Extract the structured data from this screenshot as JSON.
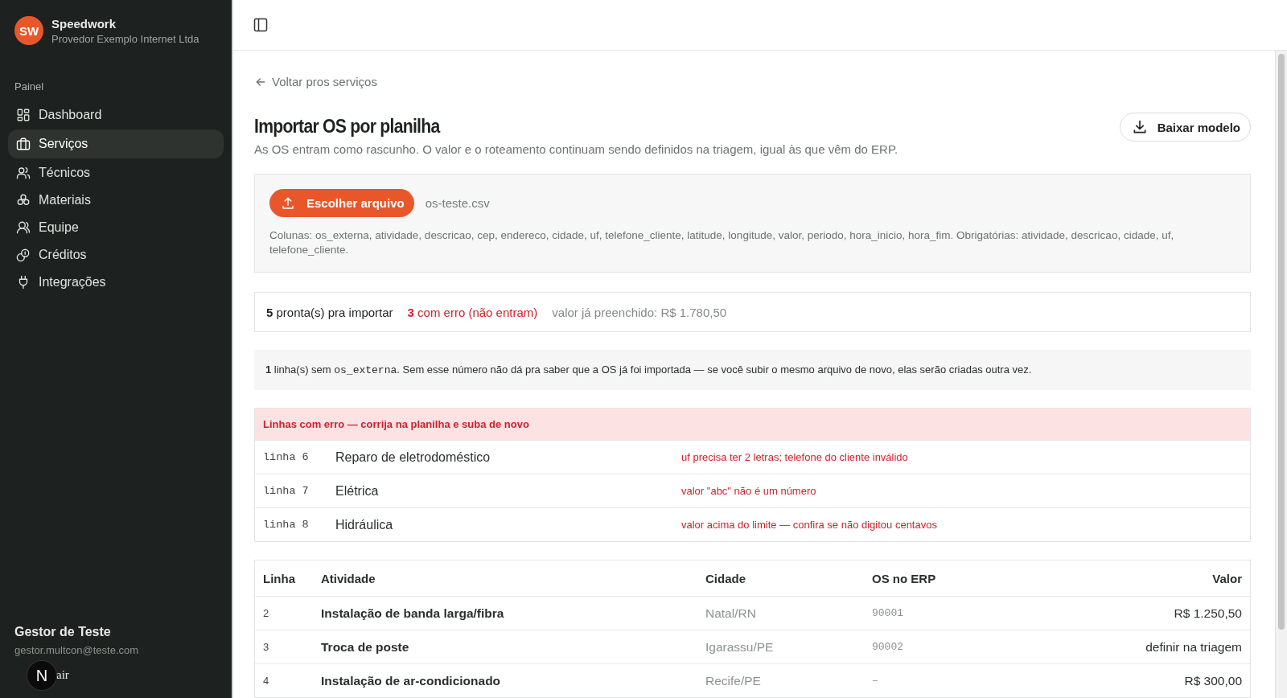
{
  "org": {
    "initials": "SW",
    "name": "Speedwork",
    "subtitle": "Provedor Exemplo Internet Ltda"
  },
  "sidebar": {
    "section": "Painel",
    "items": [
      {
        "label": "Dashboard",
        "selected": false
      },
      {
        "label": "Serviços",
        "selected": true
      },
      {
        "label": "Técnicos",
        "selected": false
      },
      {
        "label": "Materiais",
        "selected": false
      },
      {
        "label": "Equipe",
        "selected": false
      },
      {
        "label": "Créditos",
        "selected": false
      },
      {
        "label": "Integrações",
        "selected": false
      }
    ]
  },
  "user": {
    "name": "Gestor de Teste",
    "email": "gestor.multcon@teste.com",
    "logout": "air",
    "badge": "N"
  },
  "back_link": "Voltar pros serviços",
  "title": "Importar OS por planilha",
  "subtitle": "As OS entram como rascunho. O valor e o roteamento continuam sendo definidos na triagem, igual às que vêm do ERP.",
  "download_button": "Baixar modelo",
  "upload": {
    "button": "Escolher arquivo",
    "file": "os-teste.csv",
    "columns_note": "Colunas: os_externa, atividade, descricao, cep, endereco, cidade, uf, telefone_cliente, latitude, longitude, valor, periodo, hora_inicio, hora_fim. Obrigatórias: atividade, descricao, cidade, uf, telefone_cliente."
  },
  "summary": {
    "ready": "**5** pronta(s) pra importar",
    "errors": "**3** com erro (não entram)",
    "filled": "valor já preenchido: R$ 1.780,50"
  },
  "warning": [
    {
      "kind": "bold",
      "text": "1"
    },
    {
      "kind": "text",
      "text": " linha(s) sem "
    },
    {
      "kind": "code",
      "text": "os_externa"
    },
    {
      "kind": "text",
      "text": ". Sem esse número não dá pra saber que a OS já foi importada — se você subir o mesmo arquivo de novo, elas serão criadas outra vez."
    }
  ],
  "errors": {
    "title": "Linhas com erro — corrija na planilha e suba de novo",
    "rows": [
      {
        "line": "linha 6",
        "activity": "Reparo de eletrodoméstico",
        "message": "uf precisa ter 2 letras; telefone do cliente inválido"
      },
      {
        "line": "linha 7",
        "activity": "Elétrica",
        "message": "valor \"abc\" não é um número"
      },
      {
        "line": "linha 8",
        "activity": "Hidráulica",
        "message": "valor acima do limite — confira se não digitou centavos"
      }
    ]
  },
  "table": {
    "columns": [
      "Linha",
      "Atividade",
      "Cidade",
      "OS no ERP",
      "Valor"
    ],
    "rows": [
      [
        "2",
        "Instalação de banda larga/fibra",
        "Natal/RN",
        "90001",
        "R$ 1.250,50"
      ],
      [
        "3",
        "Troca de poste",
        "Igarassu/PE",
        "90002",
        "definir na triagem"
      ],
      [
        "4",
        "Instalação de ar-condicionado",
        "Recife/PE",
        "–",
        "R$ 300,00"
      ]
    ]
  }
}
